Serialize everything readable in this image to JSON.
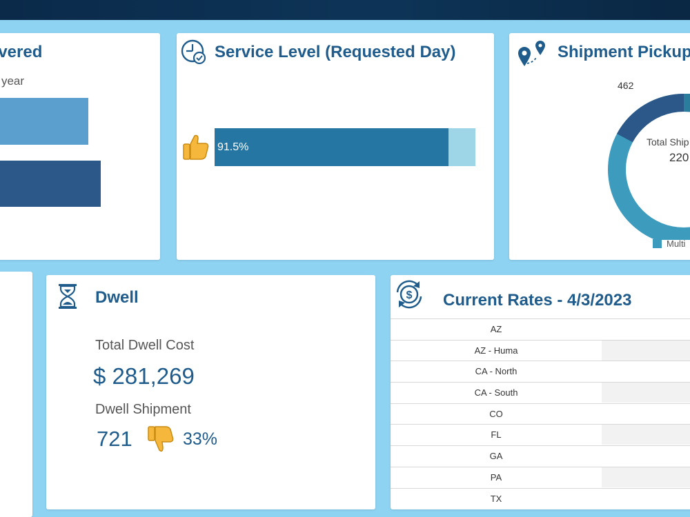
{
  "colors": {
    "background": "#8fd3f3",
    "topbar": "#0d3457",
    "title": "#1f5c8c",
    "bar_light": "#5b9fcf",
    "bar_dark": "#2b5888",
    "service_bar": "#2676a3",
    "service_remainder": "#9fd6e7",
    "donut_main": "#3d9bbd",
    "donut_dark": "#2b5888"
  },
  "delivered": {
    "title": "livered",
    "subtitle": "st year",
    "bars": [
      {
        "name": "bar-1",
        "color": "#5b9fcf"
      },
      {
        "name": "bar-2",
        "color": "#2b5888"
      }
    ]
  },
  "service_level": {
    "title": "Service Level (Requested Day)",
    "icon": "clock-check-icon",
    "thumb_icon": "thumbs-up-icon",
    "value_label": "91.5%",
    "fill_fraction": 0.915
  },
  "pickup": {
    "title": "Shipment Pickup",
    "icon": "map-pin-route-icon",
    "segment_label": "462",
    "center_label": "Total Ship",
    "center_value": "220",
    "legend_label": "Multi",
    "legend_icon": "legend-swatch"
  },
  "dwell": {
    "title": "Dwell",
    "icon": "hourglass-icon",
    "total_cost_label": "Total Dwell Cost",
    "total_cost_value": "$ 281,269",
    "shipment_label": "Dwell Shipment",
    "shipment_value": "721",
    "thumb_icon": "thumbs-down-icon",
    "shipment_percent": "33%"
  },
  "rates": {
    "title": "Current Rates  - 4/3/2023",
    "icon": "dollar-refresh-icon",
    "rows": [
      "AZ",
      "AZ - Huma",
      "CA - North",
      "CA - South",
      "CO",
      "FL",
      "GA",
      "PA",
      "TX"
    ]
  }
}
